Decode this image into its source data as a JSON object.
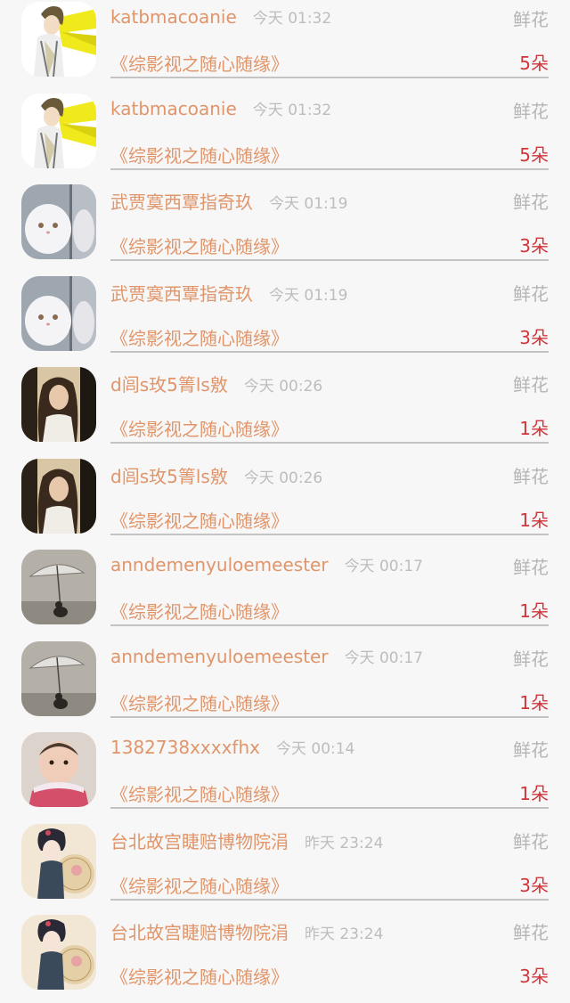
{
  "gifts": [
    {
      "name": "katbmacoanie",
      "time": "今天 01:32",
      "type": "鲜花",
      "book": "《综影视之随心随缘》",
      "amount": "5朵",
      "avatar_icon": "anime-boy-avatar-icon"
    },
    {
      "name": "katbmacoanie",
      "time": "今天 01:32",
      "type": "鲜花",
      "book": "《综影视之随心随缘》",
      "amount": "5朵",
      "avatar_icon": "anime-boy-avatar-icon"
    },
    {
      "name": "武贾寞西覃指奇玖",
      "time": "今天 01:19",
      "type": "鲜花",
      "book": "《综影视之随心随缘》",
      "amount": "3朵",
      "avatar_icon": "white-cat-avatar-icon"
    },
    {
      "name": "武贾寞西覃指奇玖",
      "time": "今天 01:19",
      "type": "鲜花",
      "book": "《综影视之随心随缘》",
      "amount": "3朵",
      "avatar_icon": "white-cat-avatar-icon"
    },
    {
      "name": "d闾s玫5箐ls敫",
      "time": "今天 00:26",
      "type": "鲜花",
      "book": "《综影视之随心随缘》",
      "amount": "1朵",
      "avatar_icon": "woman-portrait-avatar-icon"
    },
    {
      "name": "d闾s玫5箐ls敫",
      "time": "今天 00:26",
      "type": "鲜花",
      "book": "《综影视之随心随缘》",
      "amount": "1朵",
      "avatar_icon": "woman-portrait-avatar-icon"
    },
    {
      "name": "anndemenyuloemeester",
      "time": "今天 00:17",
      "type": "鲜花",
      "book": "《综影视之随心随缘》",
      "amount": "1朵",
      "avatar_icon": "umbrella-avatar-icon"
    },
    {
      "name": "anndemenyuloemeester",
      "time": "今天 00:17",
      "type": "鲜花",
      "book": "《综影视之随心随缘》",
      "amount": "1朵",
      "avatar_icon": "umbrella-avatar-icon"
    },
    {
      "name": "1382738xxxxfhx",
      "time": "今天 00:14",
      "type": "鲜花",
      "book": "《综影视之随心随缘》",
      "amount": "1朵",
      "avatar_icon": "baby-avatar-icon"
    },
    {
      "name": "台北故宫睫赔博物院涓",
      "time": "昨天 23:24",
      "type": "鲜花",
      "book": "《综影视之随心随缘》",
      "amount": "3朵",
      "avatar_icon": "ancient-lady-avatar-icon"
    },
    {
      "name": "台北故宫睫赔博物院涓",
      "time": "昨天 23:24",
      "type": "鲜花",
      "book": "《综影视之随心随缘》",
      "amount": "3朵",
      "avatar_icon": "ancient-lady-avatar-icon"
    }
  ],
  "colors": {
    "name": "#e0956a",
    "time": "#bdbdbd",
    "type": "#b5b5b5",
    "amount": "#d0363b",
    "divider": "#c4c4c4",
    "background": "#f7f7f7"
  }
}
